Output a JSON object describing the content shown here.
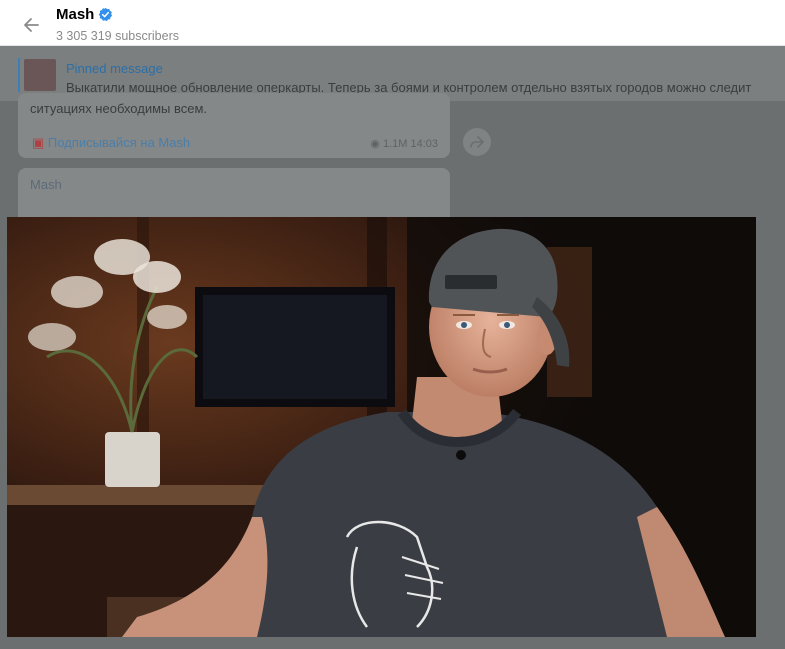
{
  "header": {
    "channel_name": "Mash",
    "subscribers": "3 305 319 subscribers"
  },
  "pinned": {
    "title": "Pinned message",
    "text": "Выкатили мощное обновление оперкарты. Теперь за боями и контролем отдельно взятых городов можно следит"
  },
  "message1": {
    "text": "ситуациях необходимы всем.",
    "link": "Подписывайся на Mash",
    "meta": "1.1M  14:03"
  },
  "message2": {
    "sender": "Mash"
  },
  "colors": {
    "accent": "#3390ec",
    "verified": "#3390ec"
  },
  "media": {
    "type": "photo"
  }
}
